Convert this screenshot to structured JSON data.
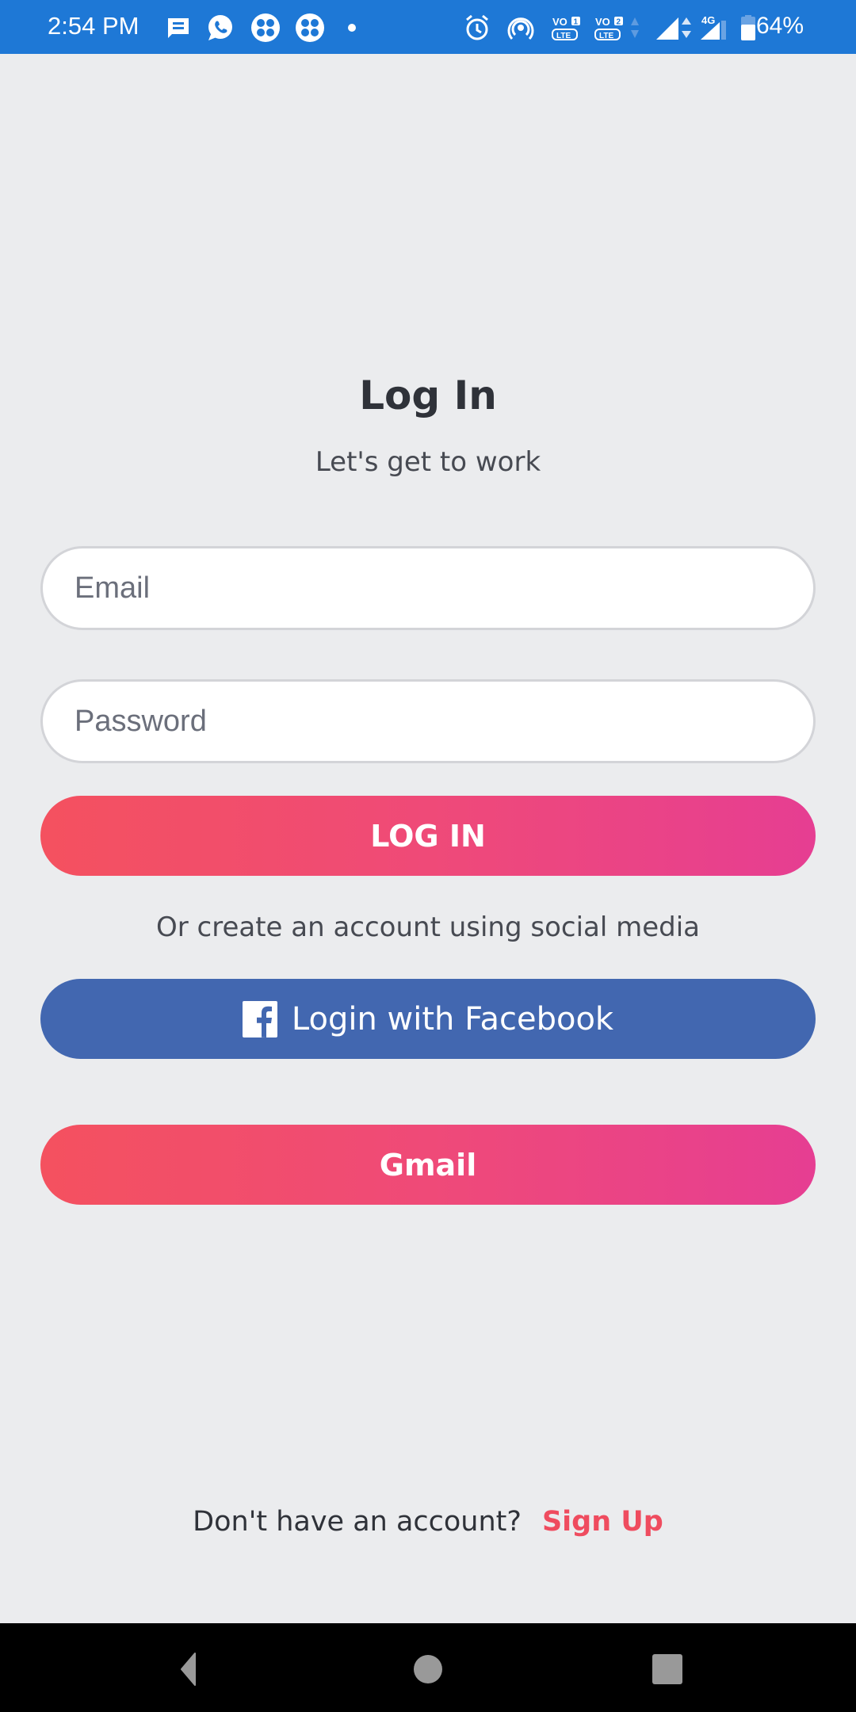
{
  "status_bar": {
    "time": "2:54 PM",
    "battery_percent": "64%",
    "network_type": "4G",
    "sim1_label": "VO 1 LTE",
    "sim2_label": "VO 2 LTE",
    "left_icons": [
      "message-icon",
      "whatsapp-icon",
      "app-icon",
      "app-icon",
      "dot-icon"
    ],
    "right_icons": [
      "alarm-icon",
      "hotspot-icon",
      "volte1-icon",
      "volte2-icon",
      "signal-icon",
      "signal-4g-icon",
      "battery-icon"
    ]
  },
  "header": {
    "title": "Log In",
    "subtitle": "Let's get to work"
  },
  "form": {
    "email": {
      "placeholder": "Email",
      "value": ""
    },
    "password": {
      "placeholder": "Password",
      "value": ""
    },
    "login_label": "LOG IN"
  },
  "social": {
    "prompt": "Or create an account using social media",
    "facebook_label": "Login with Facebook",
    "gmail_label": "Gmail"
  },
  "footer": {
    "text": "Don't have an account?",
    "signup_label": "Sign Up"
  },
  "colors": {
    "status_bar": "#1e78d6",
    "background": "#ebecee",
    "gradient_start": "#f4515f",
    "gradient_end": "#e63e92",
    "facebook": "#4267b0",
    "signup": "#ef4c5f"
  }
}
